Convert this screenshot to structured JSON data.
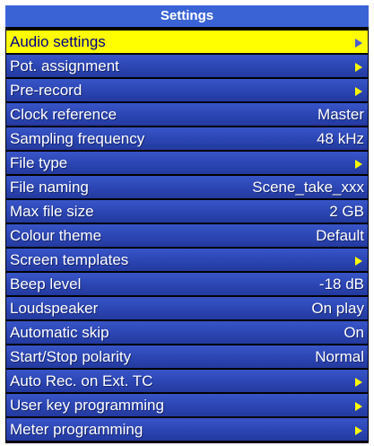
{
  "colors": {
    "title_bg": "#3a63d6",
    "row_bg": "#2c46b4",
    "selected_bg": "#ffff00",
    "arrow": "#ffff00",
    "text": "#ffffff"
  },
  "title": "Settings",
  "items": [
    {
      "label": "Audio settings",
      "value": "",
      "submenu": true,
      "selected": true,
      "icon": "submenu-arrow-icon"
    },
    {
      "label": "Pot. assignment",
      "value": "",
      "submenu": true,
      "selected": false,
      "icon": "submenu-arrow-icon"
    },
    {
      "label": "Pre-record",
      "value": "",
      "submenu": true,
      "selected": false,
      "icon": "submenu-arrow-icon"
    },
    {
      "label": "Clock reference",
      "value": "Master",
      "submenu": false,
      "selected": false
    },
    {
      "label": "Sampling frequency",
      "value": "48 kHz",
      "submenu": false,
      "selected": false
    },
    {
      "label": "File type",
      "value": "",
      "submenu": true,
      "selected": false,
      "icon": "submenu-arrow-icon"
    },
    {
      "label": "File naming",
      "value": "Scene_take_xxx",
      "submenu": false,
      "selected": false
    },
    {
      "label": "Max file size",
      "value": "2 GB",
      "submenu": false,
      "selected": false
    },
    {
      "label": "Colour theme",
      "value": "Default",
      "submenu": false,
      "selected": false
    },
    {
      "label": "Screen templates",
      "value": "",
      "submenu": true,
      "selected": false,
      "icon": "submenu-arrow-icon"
    },
    {
      "label": "Beep level",
      "value": "-18 dB",
      "submenu": false,
      "selected": false
    },
    {
      "label": "Loudspeaker",
      "value": "On play",
      "submenu": false,
      "selected": false
    },
    {
      "label": "Automatic skip",
      "value": "On",
      "submenu": false,
      "selected": false
    },
    {
      "label": "Start/Stop polarity",
      "value": "Normal",
      "submenu": false,
      "selected": false
    },
    {
      "label": "Auto Rec. on Ext. TC",
      "value": "",
      "submenu": true,
      "selected": false,
      "icon": "submenu-arrow-icon"
    },
    {
      "label": "User key programming",
      "value": "",
      "submenu": true,
      "selected": false,
      "icon": "submenu-arrow-icon"
    },
    {
      "label": "Meter programming",
      "value": "",
      "submenu": true,
      "selected": false,
      "icon": "submenu-arrow-icon"
    }
  ]
}
